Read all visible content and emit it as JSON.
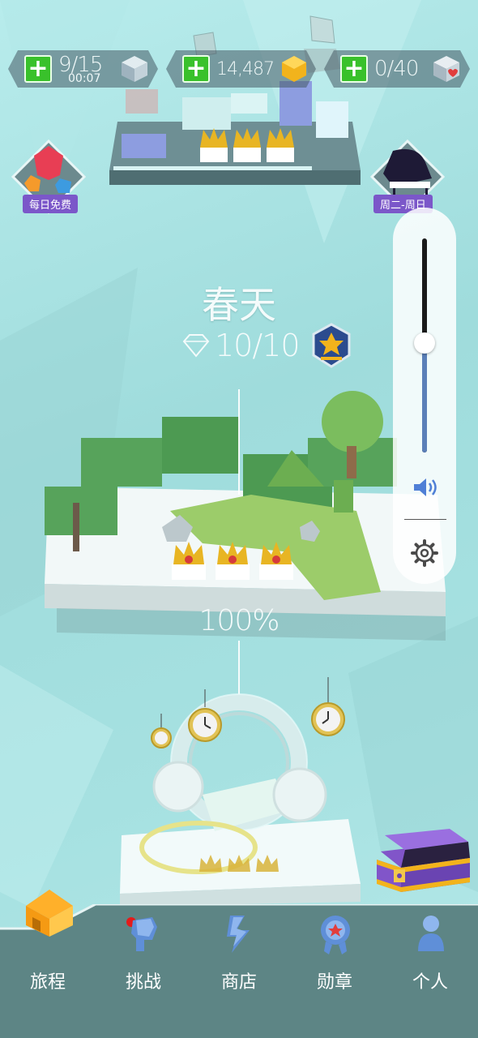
{
  "top_bar": {
    "energy": {
      "value": "9/15",
      "timer": "00:07"
    },
    "gems": {
      "value": "14,487"
    },
    "boxes": {
      "value": "0/40"
    }
  },
  "side_buttons": {
    "daily_free_label": "每日免费",
    "weekday_label": "周二-周日"
  },
  "level": {
    "title": "春天",
    "diamonds": "10/10",
    "percent": "100%"
  },
  "volume": {
    "level": 0.51
  },
  "nav": {
    "items": [
      {
        "label": "旅程",
        "icon": "house-icon",
        "active": true
      },
      {
        "label": "挑战",
        "icon": "challenge-icon",
        "badge": true
      },
      {
        "label": "商店",
        "icon": "shop-icon"
      },
      {
        "label": "勋章",
        "icon": "medal-icon"
      },
      {
        "label": "个人",
        "icon": "person-icon"
      }
    ]
  },
  "colors": {
    "background": "#a9e3e3",
    "nav": "#5d8585",
    "plus_green": "#39c12b",
    "badge_purple": "#7b57c9",
    "crown_gold": "#e8b523"
  }
}
